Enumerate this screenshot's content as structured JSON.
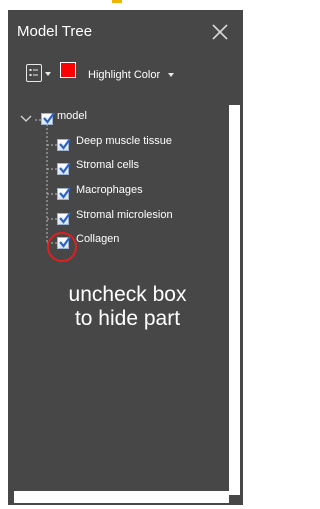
{
  "panel": {
    "title": "Model Tree",
    "toolbar": {
      "highlight_label": "Highlight Color",
      "highlight_color": "#ff0000"
    }
  },
  "tree": {
    "root": {
      "label": "model",
      "checked": true,
      "expanded": true
    },
    "children": [
      {
        "label": "Deep muscle tissue",
        "checked": true
      },
      {
        "label": "Stromal cells",
        "checked": true
      },
      {
        "label": "Macrophages",
        "checked": true
      },
      {
        "label": "Stromal microlesion",
        "checked": true
      },
      {
        "label": "Collagen",
        "checked": true
      }
    ]
  },
  "annotation": {
    "line1": "uncheck box",
    "line2": "to hide part",
    "circle_color": "#e0201f"
  }
}
